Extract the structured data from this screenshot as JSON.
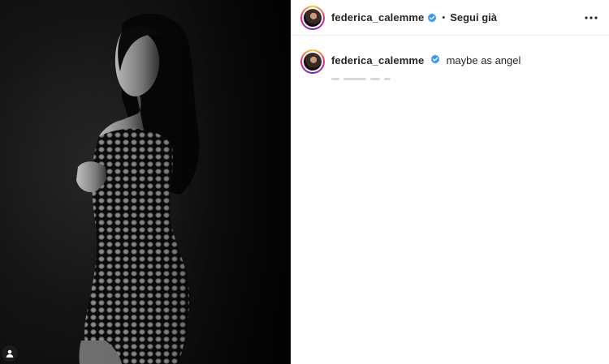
{
  "post": {
    "image": {
      "alt": "",
      "tag_icon": "user-tag-icon"
    },
    "header": {
      "username": "federica_calemme",
      "verified_icon": "verified-badge-icon",
      "separator": "•",
      "follow_label": "Segui già",
      "more_icon": "more-options-icon"
    },
    "caption": {
      "username": "federica_calemme",
      "verified_icon": "verified-badge-icon",
      "text": "maybe as angel"
    },
    "colors": {
      "verified": "#3897f0",
      "text": "#262626",
      "divider": "#efefef",
      "media_background": "#0e0e0e"
    }
  }
}
